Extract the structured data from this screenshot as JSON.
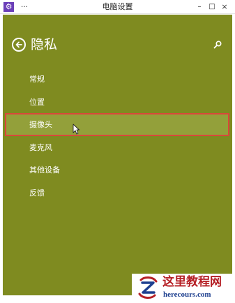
{
  "titlebar": {
    "title": "电脑设置",
    "system_menu": "…",
    "minimize": "–",
    "maximize": "□",
    "close": "×"
  },
  "header": {
    "title": "隐私",
    "back_icon": "arrow-left-circle-icon",
    "search_icon": "search-icon"
  },
  "nav": {
    "items": [
      {
        "label": "常规",
        "selected": false
      },
      {
        "label": "位置",
        "selected": false
      },
      {
        "label": "摄像头",
        "selected": true
      },
      {
        "label": "麦克风",
        "selected": false
      },
      {
        "label": "其他设备",
        "selected": false
      },
      {
        "label": "反馈",
        "selected": false
      }
    ]
  },
  "watermark": {
    "text": "这里教程网",
    "url": "herecours.com"
  },
  "colors": {
    "background": "#7f8b20",
    "selected_background": "#93a03a",
    "selected_border": "#d9473a",
    "app_icon": "#6b3fb8",
    "watermark_text": "#b51f25",
    "watermark_url": "#1d3f8f"
  }
}
